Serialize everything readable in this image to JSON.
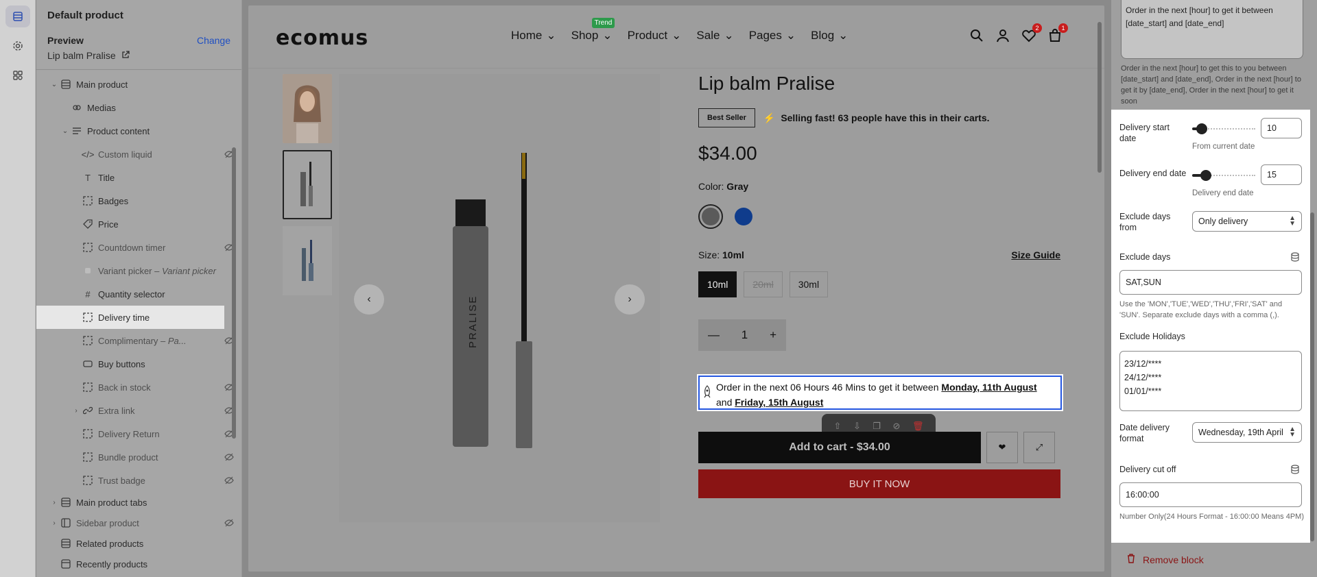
{
  "sidebar": {
    "title": "Default product",
    "preview_label": "Preview",
    "change_label": "Change",
    "product_name": "Lip balm Pralise",
    "tree": {
      "main_product": "Main product",
      "medias": "Medias",
      "product_content": "Product content",
      "custom_liquid": "Custom liquid",
      "title": "Title",
      "badges": "Badges",
      "price": "Price",
      "countdown_timer": "Countdown timer",
      "variant_picker": "Variant picker",
      "variant_picker_sub": "– Variant picker",
      "quantity_selector": "Quantity selector",
      "delivery_time": "Delivery time",
      "complimentary": "Complimentary",
      "complimentary_sub": "– Pa...",
      "buy_buttons": "Buy buttons",
      "back_in_stock": "Back in stock",
      "extra_link": "Extra link",
      "delivery_return": "Delivery Return",
      "bundle_product": "Bundle product",
      "trust_badge": "Trust badge",
      "main_product_tabs": "Main product tabs",
      "sidebar_product": "Sidebar product",
      "related_products": "Related products",
      "recently_products": "Recently products"
    }
  },
  "store": {
    "logo": "ecomus",
    "menu": [
      "Home",
      "Shop",
      "Product",
      "Sale",
      "Pages",
      "Blog"
    ],
    "trend_badge": "Trend",
    "wishlist_count": "2",
    "cart_count": "1"
  },
  "product": {
    "title": "Lip balm Pralise",
    "best_seller": "Best Seller",
    "selling_fast": "Selling fast! 63 people have this in their carts.",
    "price": "$34.00",
    "color_label": "Color:",
    "color_value": "Gray",
    "size_label": "Size:",
    "size_value": "10ml",
    "size_guide": "Size Guide",
    "sizes": [
      "10ml",
      "20ml",
      "30ml"
    ],
    "quantity": "1",
    "delivery_prefix": "Order in the next 06 Hours 46 Mins to get it between",
    "delivery_start": "Monday, 11th August",
    "delivery_and": "and",
    "delivery_end": "Friday, 15th August",
    "add_to_cart": "Add to cart - $34.00",
    "buy_now": "BUY IT NOW",
    "image_text": "PRALISE"
  },
  "settings": {
    "top_textarea": "Order in the next [hour] to get it between [date_start] and [date_end]",
    "top_help": "Order in the next [hour] to get this to you between [date_start] and [date_end], Order in the next [hour] to get it by [date_end], Order in the next [hour] to get it soon",
    "delivery_start_label": "Delivery start date",
    "delivery_start_value": "10",
    "delivery_start_sub": "From current date",
    "delivery_end_label": "Delivery end date",
    "delivery_end_value": "15",
    "delivery_end_sub": "Delivery end date",
    "exclude_from_label": "Exclude days from",
    "exclude_from_value": "Only delivery",
    "exclude_days_label": "Exclude days",
    "exclude_days_value": "SAT,SUN",
    "exclude_days_help": "Use the 'MON','TUE','WED','THU','FRI','SAT' and 'SUN'. Separate exclude days with a comma (,).",
    "holidays_label": "Exclude Holidays",
    "holidays": [
      "23/12/****",
      "24/12/****",
      "01/01/****"
    ],
    "date_format_label": "Date delivery format",
    "date_format_value": "Wednesday, 19th April",
    "cutoff_label": "Delivery cut off",
    "cutoff_value": "16:00:00",
    "cutoff_help": "Number Only(24 Hours Format - 16:00:00 Means 4PM)",
    "remove_block": "Remove block"
  },
  "colors": {
    "accent": "#2456e0",
    "buy_now": "#8a1414",
    "swatch_gray": "#5a5a5a",
    "swatch_blue": "#0f3c8c"
  }
}
